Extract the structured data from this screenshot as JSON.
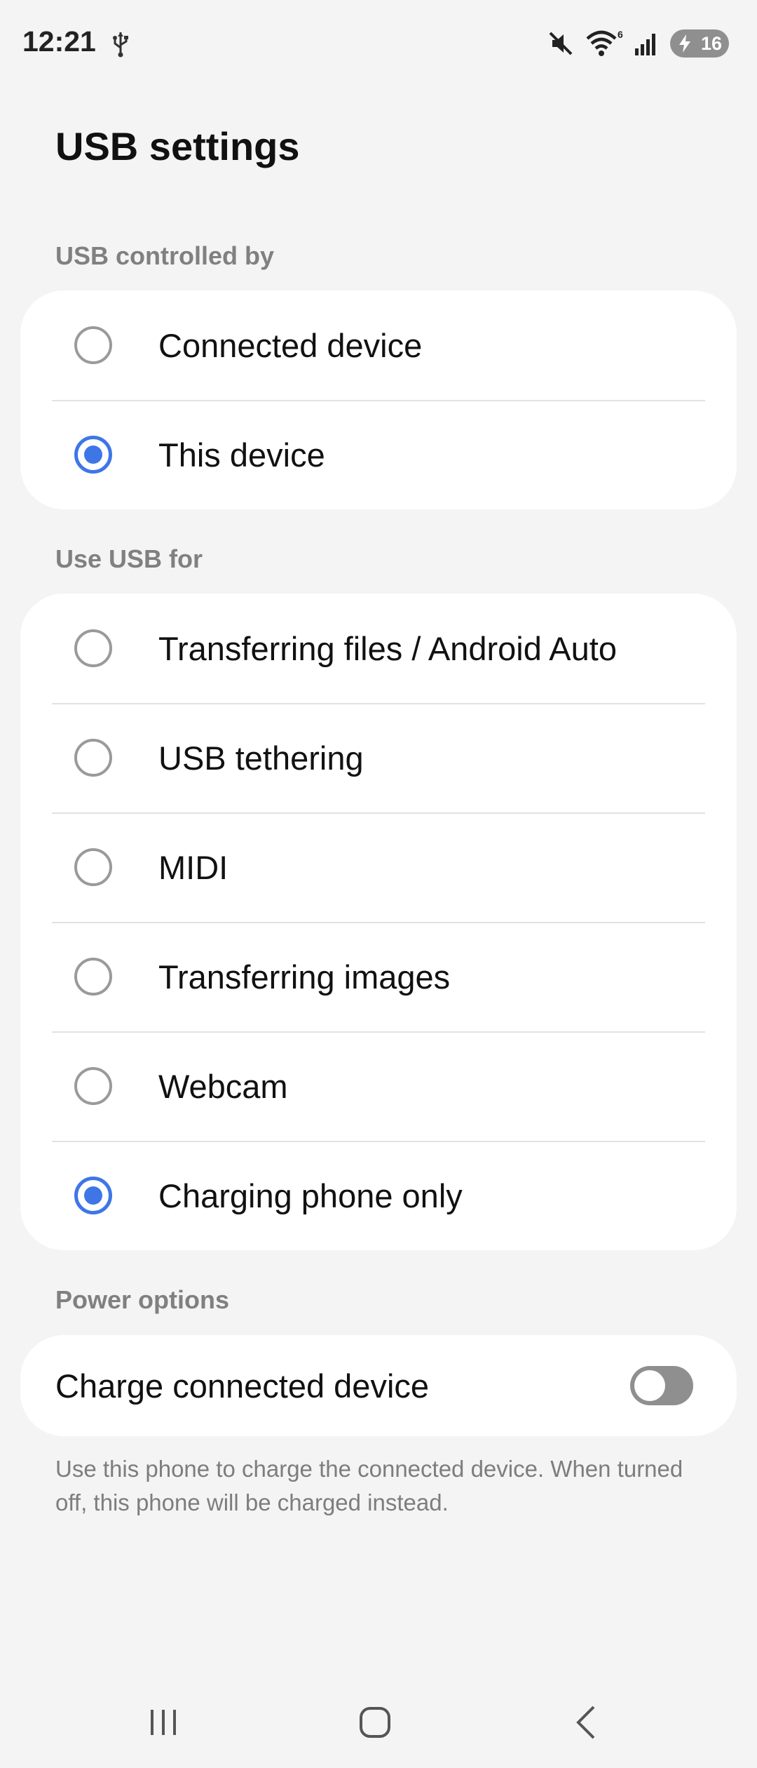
{
  "status_bar": {
    "time": "12:21",
    "battery_level": "16",
    "icons": [
      "usb-icon",
      "mute-icon",
      "wifi-icon",
      "signal-icon",
      "battery-charging-icon"
    ],
    "wifi_badge": "6"
  },
  "page": {
    "title": "USB settings"
  },
  "usb_controlled_by": {
    "label": "USB controlled by",
    "options": [
      {
        "label": "Connected device",
        "selected": false
      },
      {
        "label": "This device",
        "selected": true
      }
    ]
  },
  "use_usb_for": {
    "label": "Use USB for",
    "options": [
      {
        "label": "Transferring files / Android Auto",
        "selected": false
      },
      {
        "label": "USB tethering",
        "selected": false
      },
      {
        "label": "MIDI",
        "selected": false
      },
      {
        "label": "Transferring images",
        "selected": false
      },
      {
        "label": "Webcam",
        "selected": false
      },
      {
        "label": "Charging phone only",
        "selected": true
      }
    ]
  },
  "power_options": {
    "label": "Power options",
    "charge_connected_device": {
      "label": "Charge connected device",
      "enabled": false
    },
    "help_text": "Use this phone to charge the connected device. When turned off, this phone will be charged instead."
  },
  "nav_bar": {
    "buttons": [
      "recents-icon",
      "home-icon",
      "back-icon"
    ]
  },
  "colors": {
    "accent": "#3e76e7",
    "background": "#f4f4f5",
    "card": "#ffffff",
    "toggle_off": "#8f8f8f"
  }
}
